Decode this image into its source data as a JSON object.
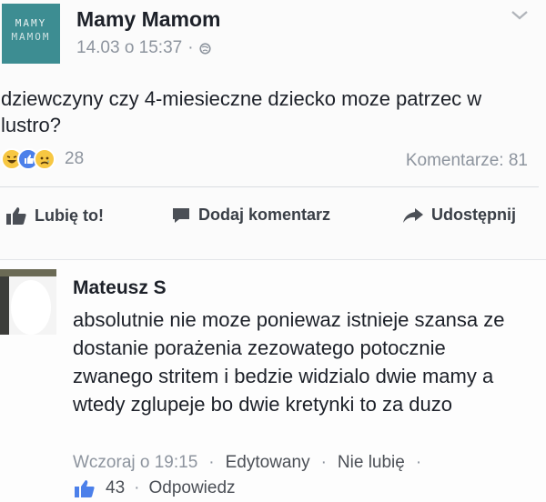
{
  "post": {
    "logo_line1": "MAMY",
    "logo_line2": "MAMOM",
    "page_name": "Mamy Mamom",
    "timestamp": "14.03 o 15:37",
    "meta_dot": "·",
    "text": "dziewczyny czy 4-miesieczne dziecko moze patrzec w lustro?",
    "reaction_count": "28",
    "comments_label": "Komentarze: 81"
  },
  "actions": {
    "like": "Lubię to!",
    "comment": "Dodaj komentarz",
    "share": "Udostępnij"
  },
  "comment": {
    "author": "Mateusz S",
    "text": "absolutnie nie moze poniewaz istnieje szansa ze dostanie porażenia zezowatego potocznie zwanego stritem i bedzie widzialo dwie mamy a wtedy zglupeje bo dwie kretynki to za duzo",
    "time": "Wczoraj o 19:15",
    "dot": "·",
    "edited": "Edytowany",
    "unlike": "Nie lubię",
    "like_count": "43",
    "reply": "Odpowiedz"
  },
  "icons": {
    "globe": "globe-icon",
    "chevron": "chevron-down-icon",
    "like": "thumbs-up-icon",
    "comment": "comment-bubble-icon",
    "share": "share-arrow-icon"
  },
  "colors": {
    "logo_bg": "#3d8d92",
    "like_blue": "#4c80ea",
    "muted": "#8d949e"
  }
}
